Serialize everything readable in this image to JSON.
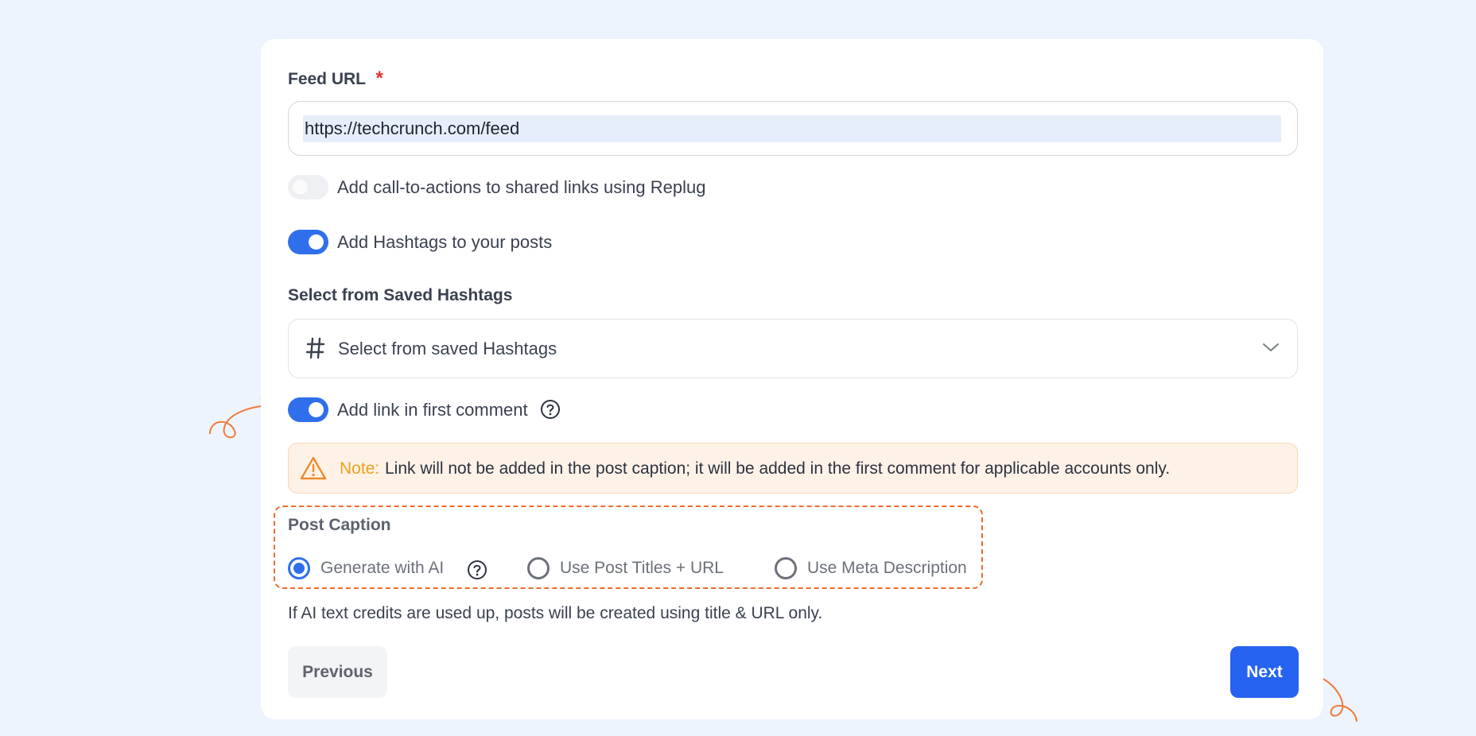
{
  "feed_url": {
    "label": "Feed URL",
    "required_mark": "*",
    "value": "https://techcrunch.com/feed"
  },
  "toggles": {
    "cta": {
      "label": "Add call-to-actions to shared links using Replug",
      "on": false
    },
    "hashtags": {
      "label": "Add Hashtags to your posts",
      "on": true
    },
    "first_comment": {
      "label": "Add link in first comment",
      "on": true
    }
  },
  "saved_hashtags": {
    "label": "Select from Saved Hashtags",
    "placeholder": "Select from saved Hashtags"
  },
  "note": {
    "title": "Note:",
    "body": "Link will not be added in the post caption; it will be added in the first comment for applicable accounts only."
  },
  "post_caption": {
    "label": "Post Caption",
    "options": [
      {
        "label": "Generate with AI",
        "selected": true
      },
      {
        "label": "Use Post Titles + URL",
        "selected": false
      },
      {
        "label": "Use Meta Description",
        "selected": false
      }
    ]
  },
  "info_text": "If AI text credits are used up, posts will be created using title & URL only.",
  "buttons": {
    "previous": "Previous",
    "next": "Next"
  },
  "colors": {
    "accent": "#2563f0",
    "annotation": "#ef6a2c",
    "note_bg": "#fef2e7",
    "page_bg": "#edf4fe"
  }
}
